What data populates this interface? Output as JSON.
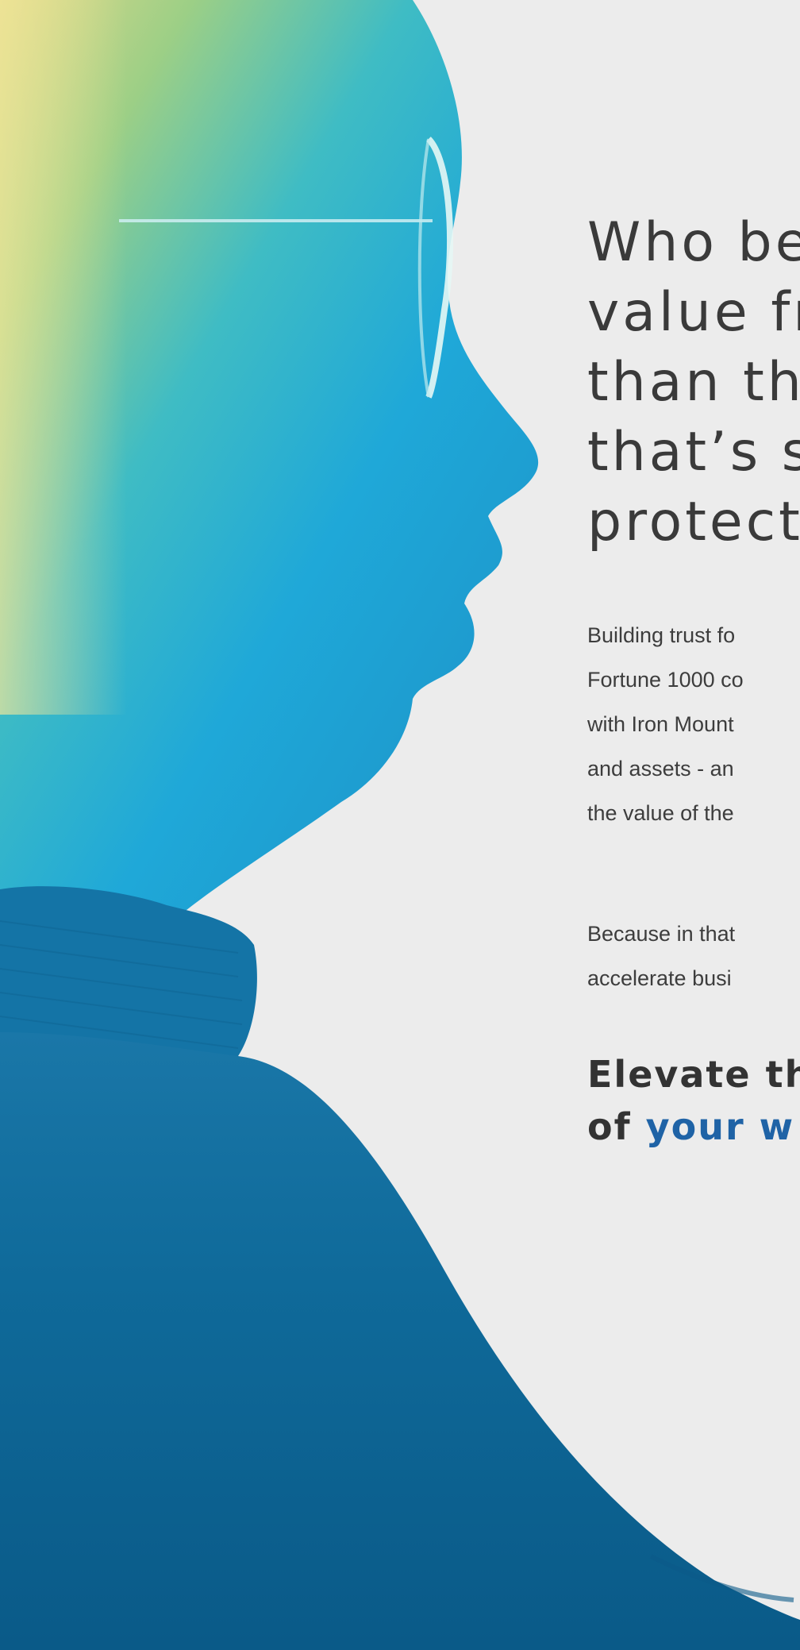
{
  "headline": {
    "lines": [
      "Who be",
      "value fr",
      "than th",
      "that’s s",
      "protect"
    ]
  },
  "body": {
    "paragraph1": [
      "Building trust fo",
      "Fortune 1000 co",
      "with Iron Mount",
      "and assets - an",
      "the value of the"
    ],
    "paragraph2": [
      "Because in that",
      "accelerate busi"
    ]
  },
  "cta": {
    "line1": "Elevate th",
    "line2_prefix": "of ",
    "line2_accent": "your w"
  },
  "colors": {
    "background": "#ececec",
    "accent": "#1f63a6",
    "gradient_top": "#d2d98a",
    "gradient_mid": "#2bb3d6",
    "gradient_bottom": "#0b5d8a"
  },
  "image": {
    "icon": "woman-profile-portrait"
  }
}
